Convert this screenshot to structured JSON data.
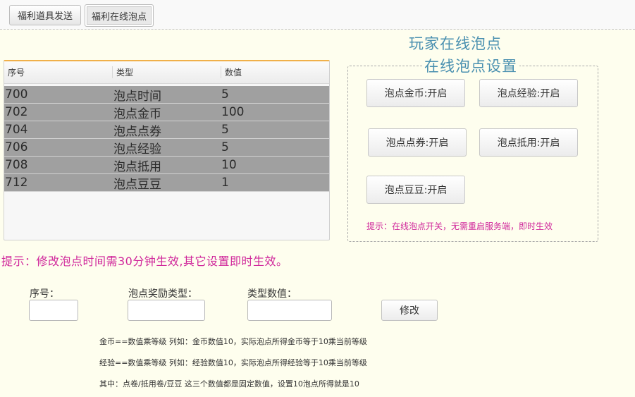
{
  "tabs": [
    {
      "label": "福利道具发送",
      "active": false
    },
    {
      "label": "福利在线泡点",
      "active": true
    }
  ],
  "page_title": "玩家在线泡点",
  "table": {
    "headers": [
      "序号",
      "类型",
      "数值"
    ],
    "rows": [
      [
        "700",
        "泡点时间",
        "5"
      ],
      [
        "702",
        "泡点金币",
        "100"
      ],
      [
        "704",
        "泡点点券",
        "5"
      ],
      [
        "706",
        "泡点经验",
        "5"
      ],
      [
        "708",
        "泡点抵用",
        "10"
      ],
      [
        "712",
        "泡点豆豆",
        "1"
      ]
    ]
  },
  "settings": {
    "legend": "在线泡点设置",
    "buttons": {
      "gold": "泡点金币:开启",
      "exp": "泡点经验:开启",
      "coupon": "泡点点券:开启",
      "voucher": "泡点抵用:开启",
      "beans": "泡点豆豆:开启"
    },
    "hint": "提示：在线泡点开关，无需重启服务端，即时生效"
  },
  "main_hint": "提示：修改泡点时间需30分钟生效,其它设置即时生效。",
  "form": {
    "seq_label": "序号：",
    "type_label": "泡点奖励类型：",
    "value_label": "类型数值：",
    "seq_value": "",
    "type_value": "",
    "value_value": "",
    "submit_label": "修改"
  },
  "notes": [
    "金币==数值乘等级  列如：金币数值10，实际泡点所得金币等于10乘当前等级",
    "经验==数值乘等级  列如：经验数值10，实际泡点所得经验等于10乘当前等级",
    "其中：点卷/抵用卷/豆豆  这三个数值都是固定数值，设置10泡点所得就是10"
  ],
  "colors": {
    "title": "#4a90b0",
    "hint": "#d0279b",
    "row_bg": "#a0a0a0",
    "accent_border": "#f0b04a"
  }
}
